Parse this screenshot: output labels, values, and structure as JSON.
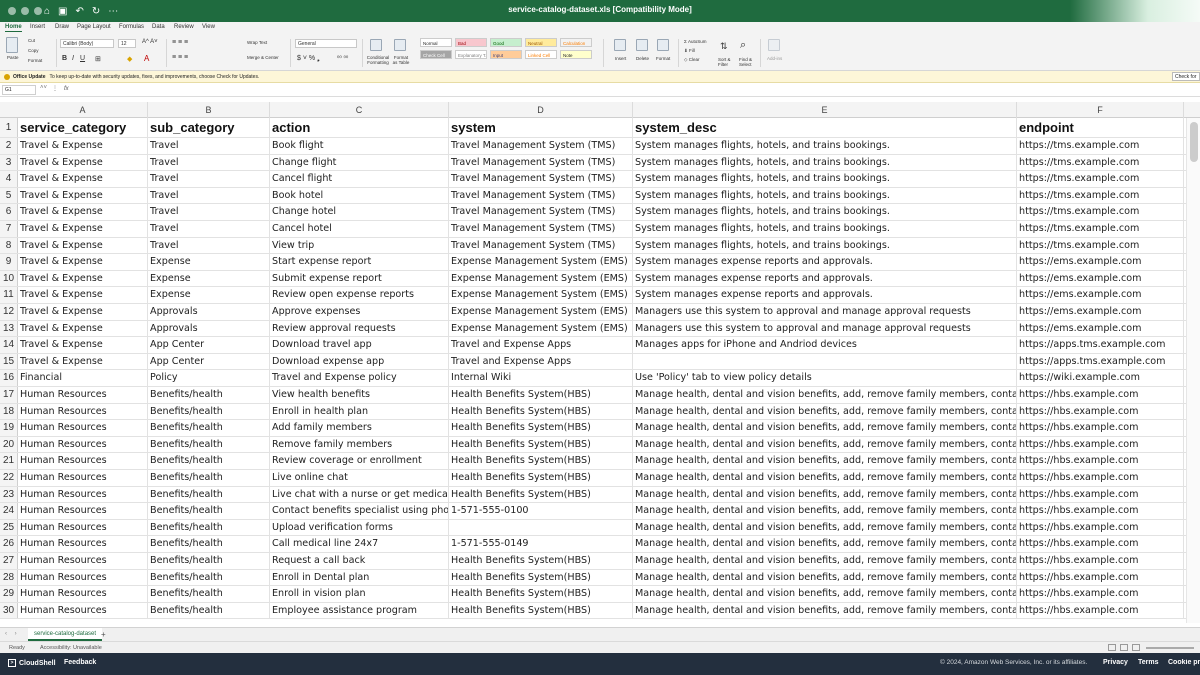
{
  "app": {
    "file_title": "service-catalog-dataset.xls  [Compatibility Mode]"
  },
  "menu_tabs": [
    "Home",
    "Insert",
    "Draw",
    "Page Layout",
    "Formulas",
    "Data",
    "Review",
    "View"
  ],
  "ribbon": {
    "paste": "Paste",
    "cut": "Cut",
    "copy": "Copy",
    "format": "Format",
    "font_name": "Calibri (Body)",
    "font_size": "12",
    "wrap_text": "Wrap Text",
    "merge_center": "Merge & Center",
    "number_format": "General",
    "conditional_formatting": "Conditional Formatting",
    "format_as_table": "Format as Table",
    "styles": [
      {
        "label": "Normal",
        "bg": "#ffffff",
        "fg": "#222222"
      },
      {
        "label": "Bad",
        "bg": "#f8c7ce",
        "fg": "#9c0006"
      },
      {
        "label": "Good",
        "bg": "#c6efce",
        "fg": "#006100"
      },
      {
        "label": "Neutral",
        "bg": "#ffeb9c",
        "fg": "#9c5700"
      },
      {
        "label": "Calculation",
        "bg": "#f2f2f2",
        "fg": "#fa7d00"
      },
      {
        "label": "Check Cell",
        "bg": "#a5a5a5",
        "fg": "#ffffff"
      },
      {
        "label": "Explanatory T...",
        "bg": "#ffffff",
        "fg": "#7f7f7f"
      },
      {
        "label": "Input",
        "bg": "#ffcc99",
        "fg": "#3f3f76"
      },
      {
        "label": "Linked Cell",
        "bg": "#ffffff",
        "fg": "#fa7d00"
      },
      {
        "label": "Note",
        "bg": "#ffffcc",
        "fg": "#222222"
      }
    ],
    "insert": "Insert",
    "delete": "Delete",
    "format_cells": "Format",
    "autosum": "AutoSum",
    "fill": "Fill",
    "clear": "Clear",
    "sort_filter": "Sort & Filter",
    "find_select": "Find & Select",
    "add_ins": "Add-ins"
  },
  "update_bar": {
    "title": "Office Update",
    "message": "To keep up-to-date with security updates, fixes, and improvements, choose Check for Updates.",
    "button": "Check for"
  },
  "formula_bar": {
    "name_box": "G1",
    "fx": "fx",
    "content": ""
  },
  "columns": [
    "A",
    "B",
    "C",
    "D",
    "E",
    "F"
  ],
  "headers": [
    "service_category",
    "sub_category",
    "action",
    "system",
    "system_desc",
    "endpoint"
  ],
  "rows": [
    [
      "Travel & Expense",
      "Travel",
      "Book flight",
      "Travel Management System (TMS)",
      "System manages flights, hotels, and trains bookings.",
      "https://tms.example.com"
    ],
    [
      "Travel & Expense",
      "Travel",
      "Change flight",
      "Travel Management System (TMS)",
      "System manages flights, hotels, and trains bookings.",
      "https://tms.example.com"
    ],
    [
      "Travel & Expense",
      "Travel",
      "Cancel flight",
      "Travel Management System (TMS)",
      "System manages flights, hotels, and trains bookings.",
      "https://tms.example.com"
    ],
    [
      "Travel & Expense",
      "Travel",
      "Book hotel",
      "Travel Management System (TMS)",
      "System manages flights, hotels, and trains bookings.",
      "https://tms.example.com"
    ],
    [
      "Travel & Expense",
      "Travel",
      "Change hotel",
      "Travel Management System (TMS)",
      "System manages flights, hotels, and trains bookings.",
      "https://tms.example.com"
    ],
    [
      "Travel & Expense",
      "Travel",
      "Cancel hotel",
      "Travel Management System (TMS)",
      "System manages flights, hotels, and trains bookings.",
      "https://tms.example.com"
    ],
    [
      "Travel & Expense",
      "Travel",
      "View trip",
      "Travel Management System (TMS)",
      "System manages flights, hotels, and trains bookings.",
      "https://tms.example.com"
    ],
    [
      "Travel & Expense",
      "Expense",
      "Start expense report",
      "Expense Management System (EMS)",
      "System manages expense reports and approvals.",
      "https://ems.example.com"
    ],
    [
      "Travel & Expense",
      "Expense",
      "Submit expense report",
      "Expense Management System (EMS)",
      "System manages expense reports and approvals.",
      "https://ems.example.com"
    ],
    [
      "Travel & Expense",
      "Expense",
      "Review open expense reports",
      "Expense Management System (EMS)",
      "System manages expense reports and approvals.",
      "https://ems.example.com"
    ],
    [
      "Travel & Expense",
      "Approvals",
      "Approve expenses",
      "Expense Management System (EMS)",
      "Managers use this system to approval and manage approval requests",
      "https://ems.example.com"
    ],
    [
      "Travel & Expense",
      "Approvals",
      "Review approval requests",
      "Expense Management System (EMS)",
      "Managers use this system to approval and manage approval requests",
      "https://ems.example.com"
    ],
    [
      "Travel & Expense",
      "App Center",
      "Download travel app",
      "Travel and Expense Apps",
      "Manages apps for iPhone and Andriod devices",
      "https://apps.tms.example.com"
    ],
    [
      "Travel & Expense",
      "App Center",
      "Download expense app",
      "Travel and Expense Apps",
      "",
      "https://apps.tms.example.com"
    ],
    [
      "Financial",
      "Policy",
      "Travel and Expense policy",
      "Internal Wiki",
      "Use 'Policy' tab to view policy details",
      "https://wiki.example.com"
    ],
    [
      "Human Resources",
      "Benefits/health",
      "View health benefits",
      "Health Benefits System(HBS)",
      "Manage health, dental and vision benefits, add, remove family members, contact specia",
      "https://hbs.example.com"
    ],
    [
      "Human Resources",
      "Benefits/health",
      "Enroll in health plan",
      "Health Benefits System(HBS)",
      "Manage health, dental and vision benefits, add, remove family members, contact specia",
      "https://hbs.example.com"
    ],
    [
      "Human Resources",
      "Benefits/health",
      "Add family members",
      "Health Benefits System(HBS)",
      "Manage health, dental and vision benefits, add, remove family members, contact specia",
      "https://hbs.example.com"
    ],
    [
      "Human Resources",
      "Benefits/health",
      "Remove family members",
      "Health Benefits System(HBS)",
      "Manage health, dental and vision benefits, add, remove family members, contact specia",
      "https://hbs.example.com"
    ],
    [
      "Human Resources",
      "Benefits/health",
      "Review coverage or enrollment",
      "Health Benefits System(HBS)",
      "Manage health, dental and vision benefits, add, remove family members, contact specia",
      "https://hbs.example.com"
    ],
    [
      "Human Resources",
      "Benefits/health",
      "Live online chat",
      "Health Benefits System(HBS)",
      "Manage health, dental and vision benefits, add, remove family members, contact specia",
      "https://hbs.example.com"
    ],
    [
      "Human Resources",
      "Benefits/health",
      "Live chat with a nurse or get medical adv",
      "Health Benefits System(HBS)",
      "Manage health, dental and vision benefits, add, remove family members, contact specia",
      "https://hbs.example.com"
    ],
    [
      "Human Resources",
      "Benefits/health",
      "Contact benefits specialist using phone",
      "1-571-555-0100",
      "Manage health, dental and vision benefits, add, remove family members, contact specia",
      "https://hbs.example.com"
    ],
    [
      "Human Resources",
      "Benefits/health",
      "Upload verification forms",
      "",
      "Manage health, dental and vision benefits, add, remove family members, contact specia",
      "https://hbs.example.com"
    ],
    [
      "Human Resources",
      "Benefits/health",
      "Call medical line 24x7",
      "1-571-555-0149",
      "Manage health, dental and vision benefits, add, remove family members, contact specia",
      "https://hbs.example.com"
    ],
    [
      "Human Resources",
      "Benefits/health",
      "Request a call back",
      "Health Benefits System(HBS)",
      "Manage health, dental and vision benefits, add, remove family members, contact specia",
      "https://hbs.example.com"
    ],
    [
      "Human Resources",
      "Benefits/health",
      "Enroll in Dental plan",
      "Health Benefits System(HBS)",
      "Manage health, dental and vision benefits, add, remove family members, contact specia",
      "https://hbs.example.com"
    ],
    [
      "Human Resources",
      "Benefits/health",
      "Enroll in vision plan",
      "Health Benefits System(HBS)",
      "Manage health, dental and vision benefits, add, remove family members, contact specia",
      "https://hbs.example.com"
    ],
    [
      "Human Resources",
      "Benefits/health",
      "Employee assistance program",
      "Health Benefits System(HBS)",
      "Manage health, dental and vision benefits, add, remove family members, contact specia",
      "https://hbs.example.com"
    ]
  ],
  "sheet_tab": "service-catalog-dataset",
  "status": {
    "ready": "Ready",
    "accessibility": "Accessibility: Unavailable"
  },
  "aws_bar": {
    "cloudshell": "CloudShell",
    "feedback": "Feedback",
    "copyright": "© 2024, Amazon Web Services, Inc. or its affiliates.",
    "privacy": "Privacy",
    "terms": "Terms",
    "cookie": "Cookie pref"
  },
  "colors": {
    "excel_green": "#1f6b3f",
    "aws_dark": "#232f3e"
  }
}
